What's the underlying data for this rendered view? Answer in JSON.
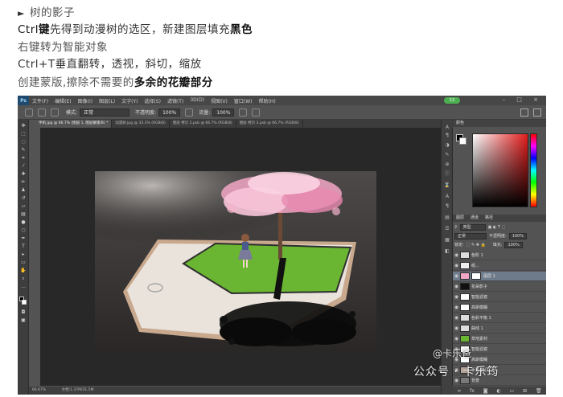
{
  "article": {
    "heading": "树的影子",
    "line2_a": "Ctrl",
    "line2_b": "键",
    "line2_c": "先得到动漫树的选区，新建图层填充",
    "line2_d": "黑色",
    "line3": "右键转为智能对象",
    "line4": "Ctrl+T垂直翻转，透视，斜切，缩放",
    "line5_a": "创建蒙版,擦除不需要的",
    "line5_b": "多余的花瓣部分"
  },
  "photoshop": {
    "logo": "Ps",
    "menu": [
      "文件(F)",
      "编辑(E)",
      "图像(I)",
      "图层(L)",
      "文字(Y)",
      "选择(S)",
      "滤镜(T)",
      "3D(D)",
      "视图(V)",
      "窗口(W)",
      "帮助(H)"
    ],
    "badge": "13",
    "options": {
      "mode_label": "模式:",
      "mode_value": "正常",
      "opacity_label": "不透明度:",
      "opacity_value": "100%",
      "flow_label": "流量:",
      "flow_value": "100%"
    },
    "tabs": [
      {
        "label": "手机.jpg @ 66.7% (图层 1, 图层蒙版/8) *",
        "active": true
      },
      {
        "label": "动漫树.jpg @ 33.3% (RGB/8)",
        "active": false
      },
      {
        "label": "图层 拷贝 2.psb @ 66.7% (RGB/8)",
        "active": false
      },
      {
        "label": "图层 拷贝 3.psb @ 66.7% (RGB/8)",
        "active": false
      }
    ],
    "status": {
      "zoom": "66.67%",
      "doc": "文档:1.37M/31.5M"
    },
    "color_panel_tab": "颜色",
    "layers_panel": {
      "tabs": [
        "图层",
        "通道",
        "路径"
      ],
      "filter_label": "类型",
      "blend": "正常",
      "opacity_label": "不透明度:",
      "opacity": "100%",
      "lock_label": "锁定:",
      "fill_label": "填充:",
      "fill": "100%",
      "layers": [
        {
          "name": "色阶 1",
          "selected": false
        },
        {
          "name": "组...",
          "selected": false
        },
        {
          "name": "图层 1",
          "selected": true
        },
        {
          "name": "花朵影子",
          "selected": false
        },
        {
          "name": "智能滤镜",
          "selected": false
        },
        {
          "name": "高斯模糊",
          "selected": false
        },
        {
          "name": "色彩平衡 1",
          "selected": false
        },
        {
          "name": "曲线 1",
          "selected": false
        },
        {
          "name": "草地素材",
          "selected": false
        },
        {
          "name": "智能滤镜",
          "selected": false
        },
        {
          "name": "高斯模糊",
          "selected": false
        },
        {
          "name": "手机 拷贝",
          "selected": false
        },
        {
          "name": "背景",
          "selected": false
        }
      ]
    }
  },
  "watermark": {
    "line1": "@卡乐爸",
    "line2": "公众号 · 卡乐筠"
  },
  "colors": {
    "ps_dark": "#535353",
    "selected_layer": "#6e7b8b",
    "grass": "#6ab531",
    "blossom": "#f2a6c4"
  }
}
